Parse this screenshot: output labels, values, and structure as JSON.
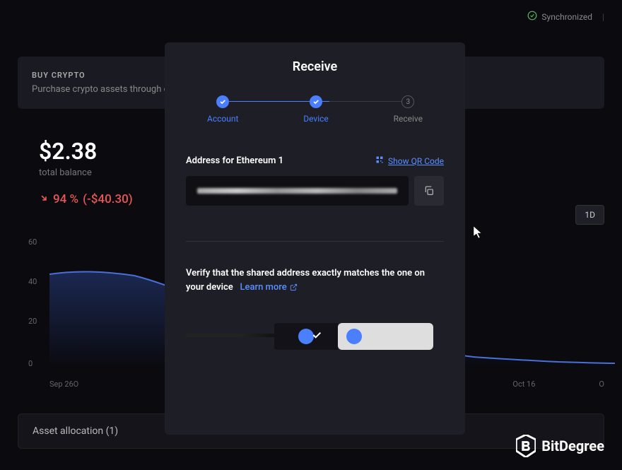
{
  "status": {
    "sync_label": "Synchronized"
  },
  "banner": {
    "title": "BUY CRYPTO",
    "subtitle": "Purchase crypto assets through our"
  },
  "portfolio": {
    "balance": "$2.38",
    "balance_label": "total balance",
    "change_pct": "94 %",
    "change_abs": "(-$40.30)"
  },
  "timeframe": {
    "selected": "1D"
  },
  "chart_data": {
    "type": "area",
    "y_ticks": [
      "60",
      "40",
      "20",
      "0"
    ],
    "x_ticks": [
      "Sep 26",
      "O",
      "Oct 16",
      "O"
    ],
    "ylim": [
      0,
      60
    ],
    "series": [
      {
        "name": "balance",
        "values": [
          42,
          44,
          41,
          36,
          30,
          25,
          22,
          20,
          18,
          16,
          14,
          11,
          9,
          7,
          5,
          4,
          3,
          3,
          2,
          2
        ]
      }
    ]
  },
  "asset_allocation": {
    "label": "Asset allocation (1)"
  },
  "modal": {
    "title": "Receive",
    "steps": [
      {
        "label": "Account",
        "state": "done"
      },
      {
        "label": "Device",
        "state": "done"
      },
      {
        "label": "Receive",
        "state": "pending",
        "num": "3"
      }
    ],
    "address_label": "Address for Ethereum 1",
    "qr_link": "Show QR Code",
    "verify_text": "Verify that the shared address exactly matches the one on your device",
    "learn_more": "Learn more"
  },
  "watermark": {
    "text": "BitDegree"
  }
}
